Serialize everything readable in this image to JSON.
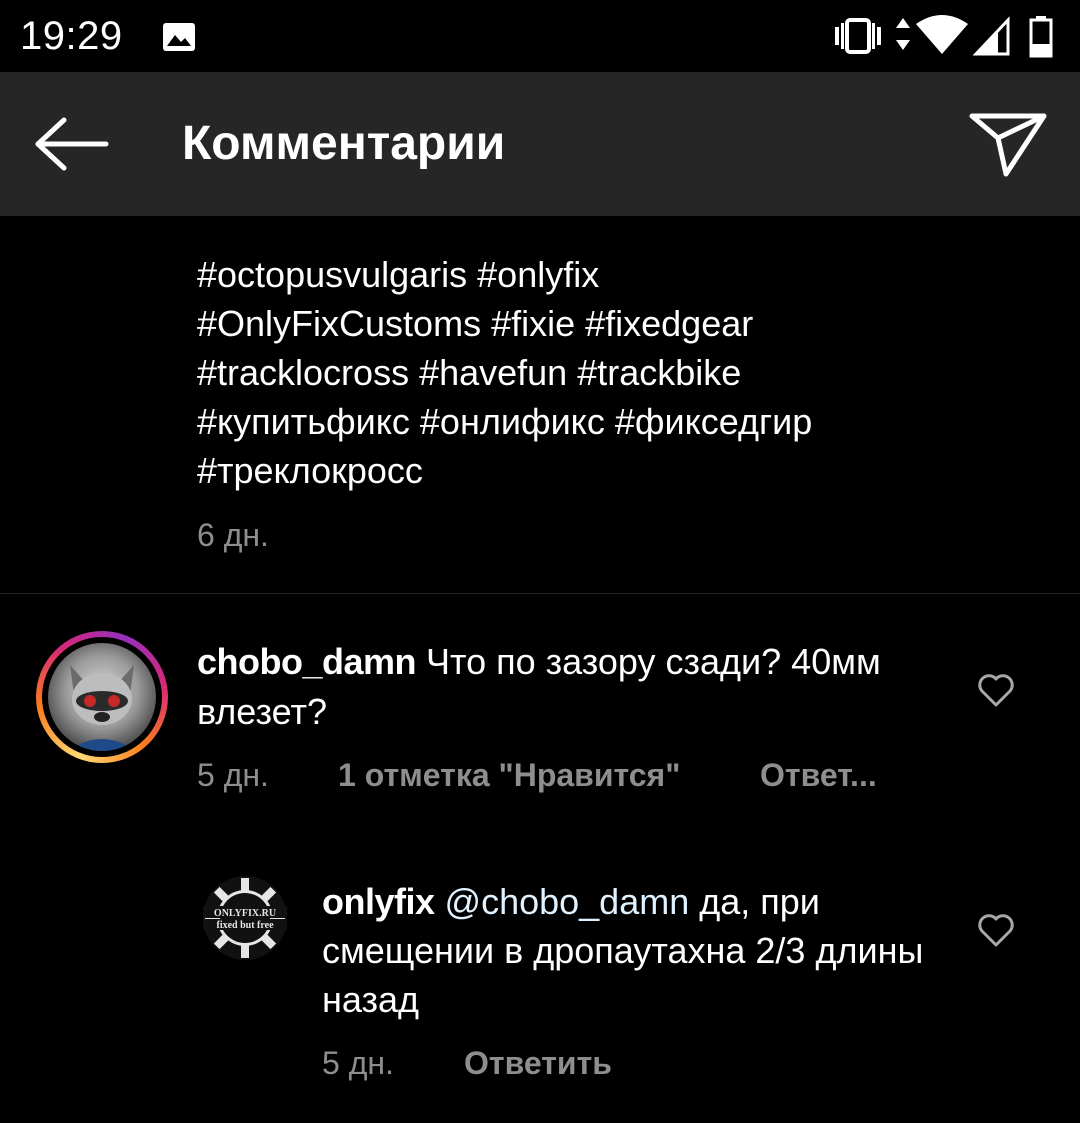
{
  "status_bar": {
    "time": "19:29"
  },
  "header": {
    "title": "Комментарии"
  },
  "caption": {
    "lines": [
      "#octopusvulgaris #onlyfix",
      "#OnlyFixCustoms #fixie #fixedgear",
      "#tracklocross #havefun #trackbike",
      "#купитьфикс #онлификс #фикседгир",
      "#треклокросс"
    ],
    "time": "6 дн."
  },
  "comments": [
    {
      "username": "chobo_damn",
      "text": " Что по зазору сзади? 40мм влезет?",
      "time": "5 дн.",
      "likes": "1 отметка \"Нравится\"",
      "reply_label": "Ответ..."
    }
  ],
  "replies": [
    {
      "username": "onlyfix",
      "mention": "@chobo_damn",
      "text": " да, при смещении в дропаутахна 2/3 длины назад",
      "time": "5 дн.",
      "reply_label": "Ответить",
      "avatar_logo": [
        "ONLYFIX.RU",
        "fixed but free"
      ]
    }
  ],
  "colors": {
    "background": "#000000",
    "app_bar": "#262626",
    "secondary_text": "#8e8e8e"
  },
  "icons": [
    "gallery-icon",
    "vibrate-icon",
    "data-arrows-icon",
    "wifi-icon",
    "signal-icon",
    "battery-icon",
    "back-arrow-icon",
    "send-icon",
    "heart-icon"
  ]
}
